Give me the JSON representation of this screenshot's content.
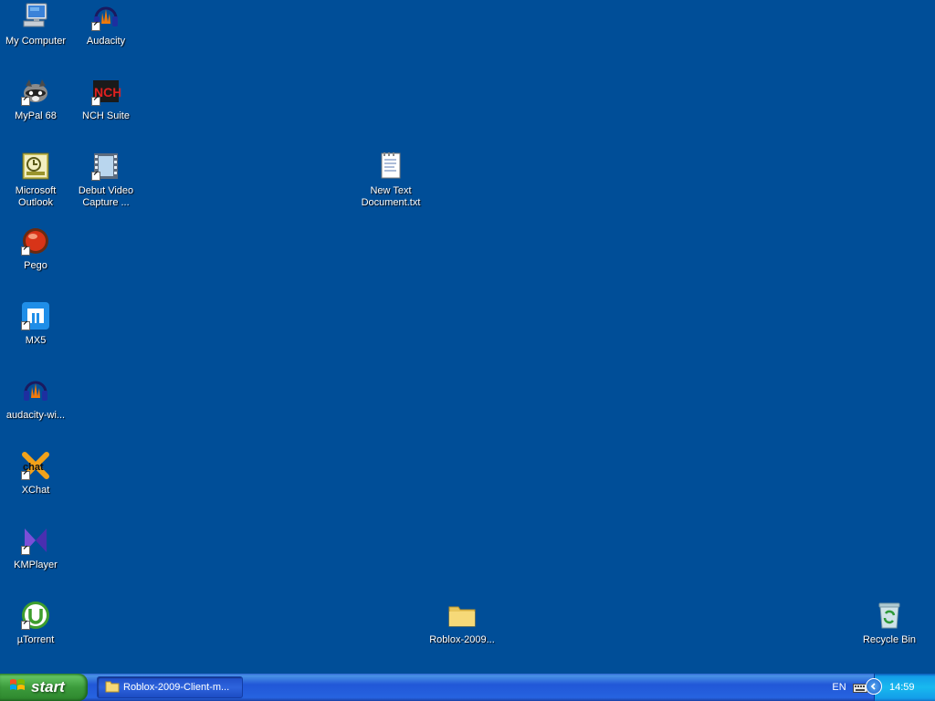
{
  "desktop": {
    "icons": [
      {
        "label": "My Computer",
        "icon": "my-computer-icon",
        "shortcut": false
      },
      {
        "label": "Audacity",
        "icon": "audacity-icon",
        "shortcut": true
      },
      {
        "label": "MyPal 68",
        "icon": "mypal-icon",
        "shortcut": true
      },
      {
        "label": "NCH Suite",
        "icon": "nch-suite-icon",
        "shortcut": true
      },
      {
        "label": "Microsoft Outlook",
        "icon": "outlook-icon",
        "shortcut": false
      },
      {
        "label": "Debut Video Capture ...",
        "icon": "debut-video-icon",
        "shortcut": true
      },
      {
        "label": "New Text Document.txt",
        "icon": "text-document-icon",
        "shortcut": false
      },
      {
        "label": "Pego",
        "icon": "pego-icon",
        "shortcut": true
      },
      {
        "label": "MX5",
        "icon": "mx5-icon",
        "shortcut": true
      },
      {
        "label": "audacity-wi...",
        "icon": "audacity-installer-icon",
        "shortcut": false
      },
      {
        "label": "XChat",
        "icon": "xchat-icon",
        "shortcut": true
      },
      {
        "label": "KMPlayer",
        "icon": "kmplayer-icon",
        "shortcut": true
      },
      {
        "label": "µTorrent",
        "icon": "utorrent-icon",
        "shortcut": true
      },
      {
        "label": "Roblox-2009...",
        "icon": "folder-icon",
        "shortcut": false
      },
      {
        "label": "Recycle Bin",
        "icon": "recycle-bin-icon",
        "shortcut": false
      }
    ]
  },
  "taskbar": {
    "start_label": "start",
    "task_label": "Roblox-2009-Client-m...",
    "language": "EN",
    "clock": "14:59"
  },
  "colors": {
    "desktop_bg": "#004e98",
    "taskbar_blue": "#2157d7",
    "start_green": "#3c9b3c"
  }
}
